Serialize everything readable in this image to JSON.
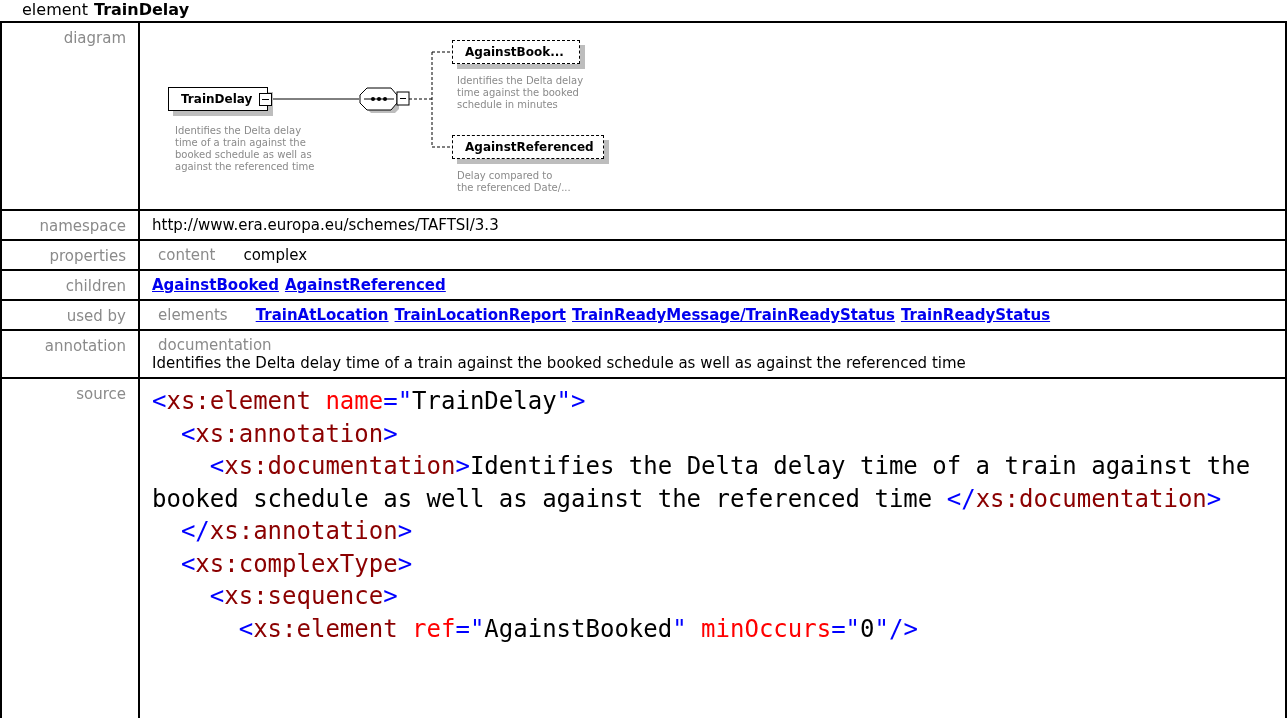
{
  "title": {
    "prefix": "element",
    "name": "TrainDelay"
  },
  "diagram": {
    "label": "diagram",
    "element": {
      "name": "TrainDelay",
      "description": [
        "Identifies the Delta delay",
        "time of a train against the",
        "booked schedule as well as",
        "against the referenced time"
      ]
    },
    "children": [
      {
        "name": "AgainstBook...",
        "description": [
          "Identifies the Delta delay",
          "time against the booked",
          "schedule in minutes"
        ]
      },
      {
        "name": "AgainstReferenced",
        "description": [
          "Delay compared to",
          "the referenced Date/..."
        ]
      }
    ]
  },
  "namespace": {
    "label": "namespace",
    "value": "http://www.era.europa.eu/schemes/TAFTSI/3.3"
  },
  "properties": {
    "label": "properties",
    "key": "content",
    "value": "complex"
  },
  "children": {
    "label": "children",
    "links": [
      "AgainstBooked",
      "AgainstReferenced"
    ]
  },
  "used_by": {
    "label": "used by",
    "key": "elements",
    "links": [
      "TrainAtLocation",
      "TrainLocationReport",
      "TrainReadyMessage/TrainReadyStatus",
      "TrainReadyStatus"
    ]
  },
  "annotation": {
    "label": "annotation",
    "key": "documentation",
    "text": "Identifies the Delta delay time of a train against the booked schedule as well as against the referenced time"
  },
  "source": {
    "label": "source",
    "lines": [
      [
        {
          "kind": "punct",
          "text": "<"
        },
        {
          "kind": "tag",
          "text": "xs:element"
        },
        {
          "kind": "attr",
          "text": " name"
        },
        {
          "kind": "punct",
          "text": "=\""
        },
        {
          "kind": "text",
          "text": "TrainDelay"
        },
        {
          "kind": "punct",
          "text": "\">"
        }
      ],
      [
        {
          "kind": "punct",
          "text": "  <"
        },
        {
          "kind": "tag",
          "text": "xs:annotation"
        },
        {
          "kind": "punct",
          "text": ">"
        }
      ],
      [
        {
          "kind": "punct",
          "text": "    <"
        },
        {
          "kind": "tag",
          "text": "xs:documentation"
        },
        {
          "kind": "punct",
          "text": ">"
        },
        {
          "kind": "text",
          "text": "Identifies the Delta delay time of a train against the"
        }
      ],
      [
        {
          "kind": "text",
          "text": "booked schedule as well as against the referenced time "
        },
        {
          "kind": "punct",
          "text": "</"
        },
        {
          "kind": "tag",
          "text": "xs:documentation"
        },
        {
          "kind": "punct",
          "text": ">"
        }
      ],
      [
        {
          "kind": "punct",
          "text": "  </"
        },
        {
          "kind": "tag",
          "text": "xs:annotation"
        },
        {
          "kind": "punct",
          "text": ">"
        }
      ],
      [
        {
          "kind": "punct",
          "text": "  <"
        },
        {
          "kind": "tag",
          "text": "xs:complexType"
        },
        {
          "kind": "punct",
          "text": ">"
        }
      ],
      [
        {
          "kind": "punct",
          "text": "    <"
        },
        {
          "kind": "tag",
          "text": "xs:sequence"
        },
        {
          "kind": "punct",
          "text": ">"
        }
      ],
      [
        {
          "kind": "punct",
          "text": "      <"
        },
        {
          "kind": "tag",
          "text": "xs:element"
        },
        {
          "kind": "attr",
          "text": " ref"
        },
        {
          "kind": "punct",
          "text": "=\""
        },
        {
          "kind": "text",
          "text": "AgainstBooked"
        },
        {
          "kind": "punct",
          "text": "\""
        },
        {
          "kind": "attr",
          "text": " minOccurs"
        },
        {
          "kind": "punct",
          "text": "=\""
        },
        {
          "kind": "text",
          "text": "0"
        },
        {
          "kind": "punct",
          "text": "\"/>"
        }
      ]
    ]
  }
}
